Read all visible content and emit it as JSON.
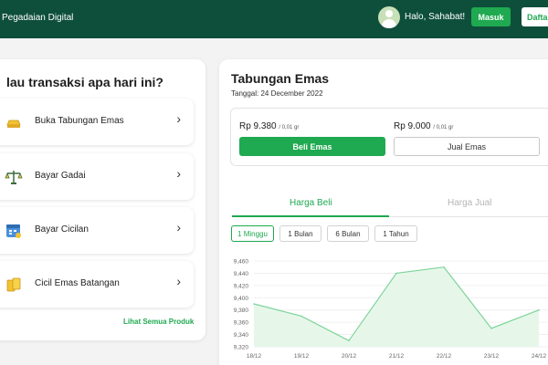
{
  "header": {
    "brand": "Pegadaian Digital",
    "avatar_icon": "user-avatar-icon",
    "greeting": "Halo, Sahabat!",
    "login_label": "Masuk",
    "register_label": "Dafta"
  },
  "left": {
    "title": "lau transaksi apa hari ini?",
    "products": [
      {
        "label": "Buka Tabungan Emas",
        "icon": "gold-bar-icon"
      },
      {
        "label": "Bayar Gadai",
        "icon": "scale-icon"
      },
      {
        "label": "Bayar Cicilan",
        "icon": "calendar-icon"
      },
      {
        "label": "Cicil Emas Batangan",
        "icon": "gold-bars-icon"
      }
    ],
    "see_all": "Lihat Semua Produk"
  },
  "savings": {
    "title": "Tabungan Emas",
    "date": "Tanggal: 24 December 2022",
    "buy_price": "Rp 9.380",
    "buy_unit": "/ 0,01 gr",
    "sell_price": "Rp 9.000",
    "sell_unit": "/ 0,01 gr",
    "buy_button": "Beli Emas",
    "sell_button": "Jual Emas",
    "tabs": [
      "Harga Beli",
      "Harga Jual"
    ],
    "periods": [
      "1 Minggu",
      "1 Bulan",
      "6 Bulan",
      "1 Tahun"
    ],
    "active_period": "1 Minggu"
  },
  "colors": {
    "header": "#0e4f3b",
    "accent": "#1fa950"
  },
  "chart_data": {
    "type": "area",
    "x": [
      "18/12",
      "19/12",
      "20/12",
      "21/12",
      "22/12",
      "23/12",
      "24/12"
    ],
    "values": [
      9390,
      9370,
      9330,
      9440,
      9450,
      9350,
      9380
    ],
    "yticks": [
      "9,460",
      "9,440",
      "9,420",
      "9,400",
      "9,380",
      "9,360",
      "9,340",
      "9,320"
    ],
    "ylim": [
      9320,
      9460
    ],
    "grid": true,
    "line_color": "#7ed49a",
    "fill_color": "#e6f7ea"
  }
}
